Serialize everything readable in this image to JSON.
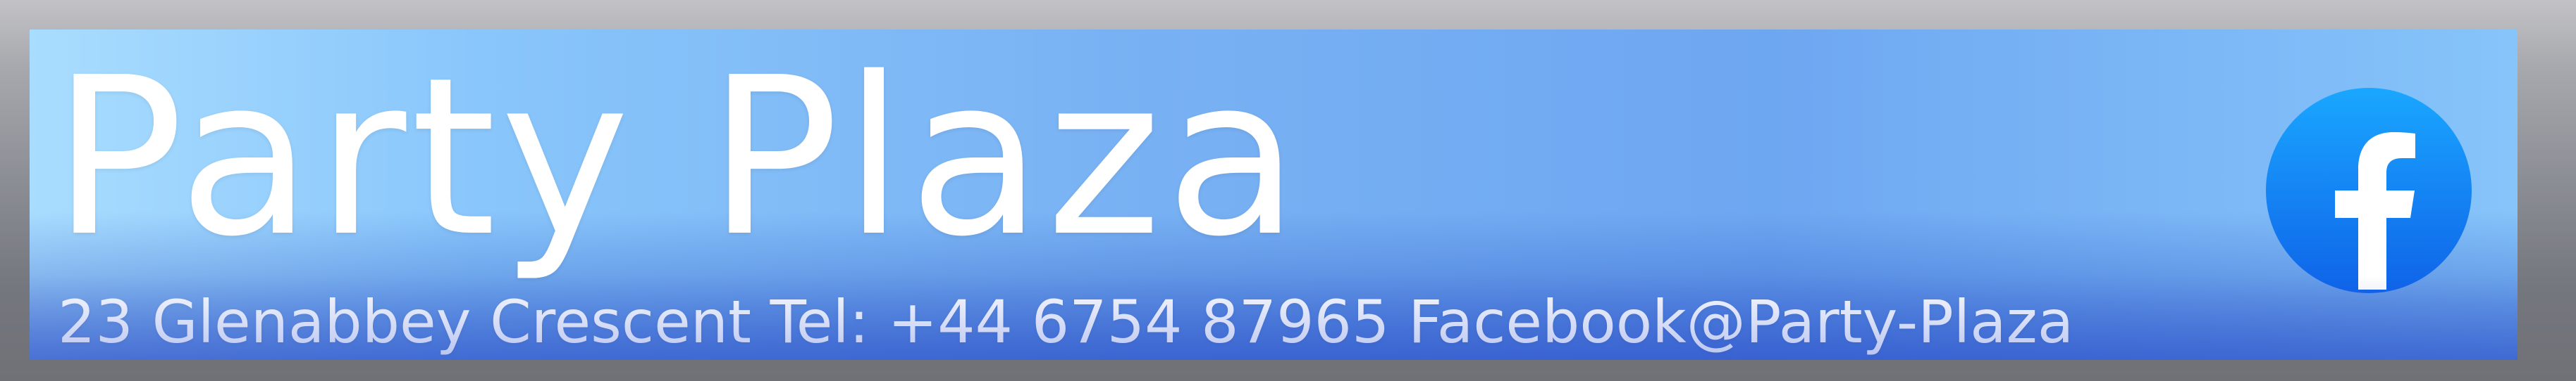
{
  "banner": {
    "title": "Party Plaza",
    "address": "23 Glenabbey Crescent",
    "phone_label": "Tel:",
    "phone_number": "+44 6754 87965",
    "social_handle": "Facebook@Party-Plaza",
    "social_icon": "facebook-icon"
  },
  "colors": {
    "banner_light": "#a9ddff",
    "banner_mid": "#78b1f3",
    "banner_dark": "#3a4fc2",
    "facebook_blue": "#1877f2",
    "text": "#ffffff"
  }
}
